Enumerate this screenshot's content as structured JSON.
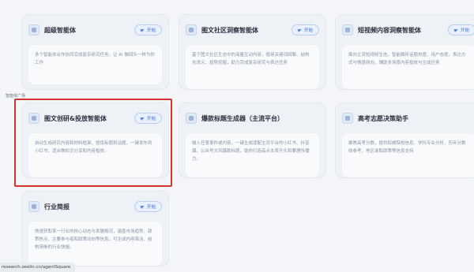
{
  "section_label": "智能体广场",
  "open_label": "开始",
  "status_url": "research.zeelin.cn/agentSquare",
  "cards": [
    {
      "title": "超级智能体",
      "desc": "多个智能体合作协同完成复杂研究任务，让 AI 做回队一样为你工作",
      "icon": "agent-icon"
    },
    {
      "title": "图文社区洞察智能体",
      "desc": "基于图文社区生态中的海量互动内容，使用关键词回聊、结构化语义、趋势挖掘，助力完成复杂研究与表达任务",
      "icon": "agent-icon"
    },
    {
      "title": "短视频内容洞察智能体",
      "desc": "面向主流短视频生态，智能解析话题热度、用户态度、表达方式与情感倾向，辅助多场景内容投放与生成任务",
      "icon": "agent-icon"
    },
    {
      "title": "图文创研&投放智能体",
      "desc": "自动生成研究内容和材料框架，提炼标题和话题，一键发布到小红书，适合做知识分享和内容投放。",
      "icon": "agent-icon"
    },
    {
      "title": "爆款标题生成器（主流平台）",
      "desc": "输入任意事件或内容，一键生成适配主流平台的小红书、抖音爆、公众号文风爆款标题，助你打造高点击率开头和要理传播力。",
      "icon": "agent-icon"
    },
    {
      "title": "高考志愿决策助手",
      "desc": "聚焦高考分数，提供权威院校信息、学科专业分析、历年分数线参考、地区录取政策等信息支持",
      "icon": "agent-icon"
    },
    {
      "title": "行业简报",
      "desc": "快速获取某一行业的核心动态与发展概况，涵盖市场趋势、政策热点、主要参与者和政策动向等信息。可生成内容简洁、结构清晰的行业快报。",
      "icon": "agent-icon"
    }
  ]
}
